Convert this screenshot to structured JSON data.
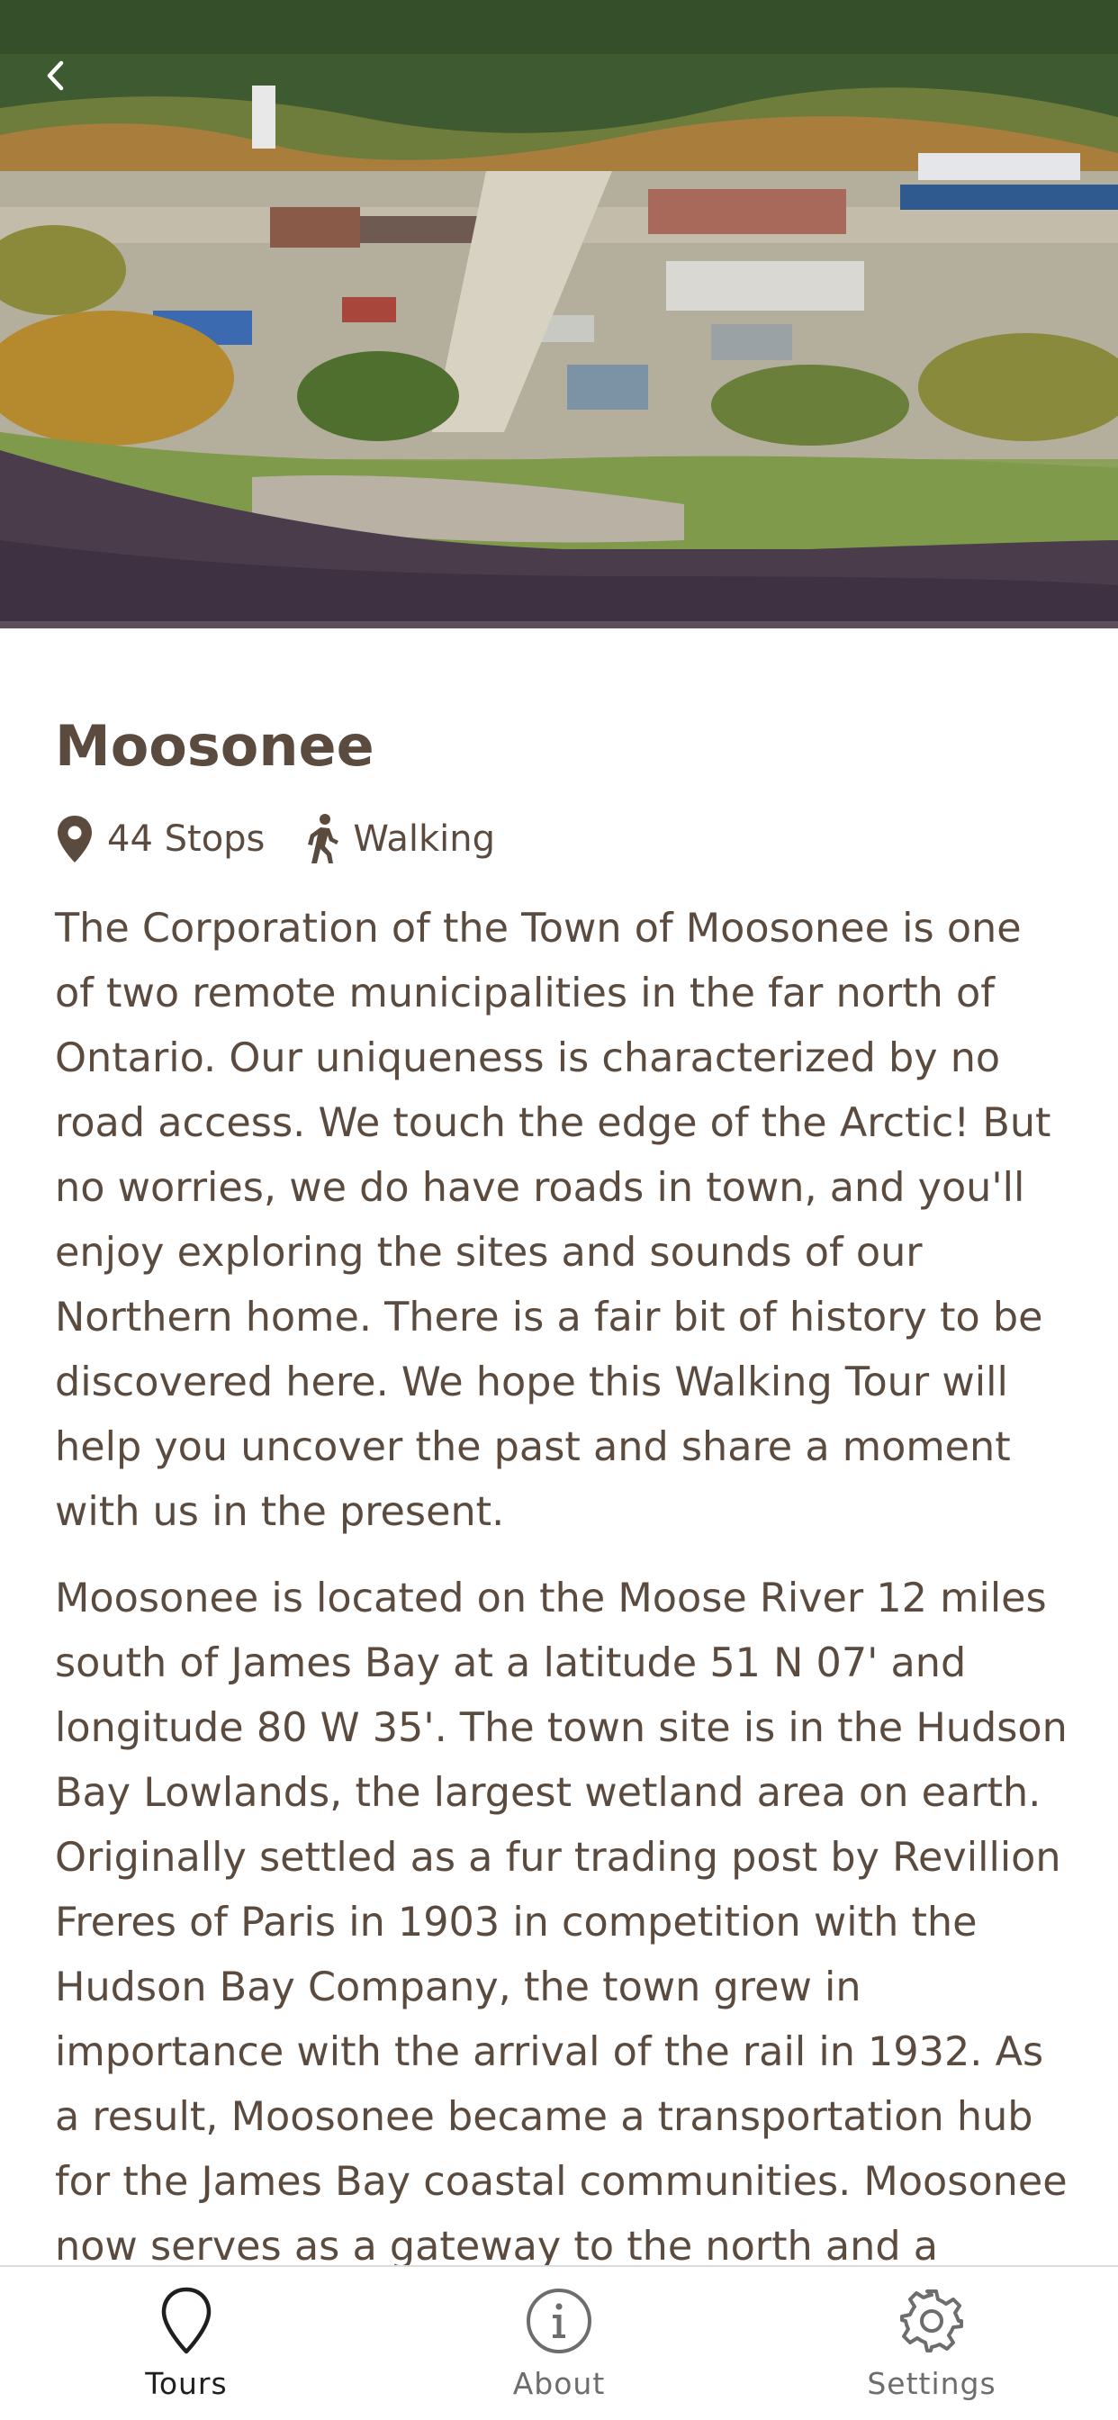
{
  "hero": {
    "image_description_icon": "aerial-town-river-photo",
    "back_icon": "chevron-left-icon"
  },
  "tour": {
    "title": "Moosonee",
    "stops_label": "44 Stops",
    "mode_label": "Walking",
    "paragraphs": [
      "The Corporation of the Town of Moosonee is one of two remote municipalities in the far north of Ontario. Our uniqueness is characterized by no road access. We touch the edge of the Arctic! But no worries, we do have roads in town, and you'll enjoy exploring the sites and sounds of our Northern home. There is a fair bit of history to be discovered here. We hope this Walking Tour will help you uncover the past and share a moment with us in the present.",
      "Moosonee is located on the Moose River 12 miles south of James Bay at a latitude 51 N 07' and longitude 80 W 35'. The town site is in the Hudson Bay Lowlands, the largest wetland area on earth. Originally settled as a fur trading post by Revillion Freres of Paris in 1903 in competition with the Hudson Bay Company, the town grew in importance with the arrival of the rail in 1932. As a result, Moosonee became a transportation hub for the James Bay coastal communities. Moosonee now serves as a gateway to the north and a launching"
    ]
  },
  "tabs": [
    {
      "label": "Tours",
      "icon": "map-pin-icon",
      "active": true
    },
    {
      "label": "About",
      "icon": "info-icon",
      "active": false
    },
    {
      "label": "Settings",
      "icon": "gear-icon",
      "active": false
    }
  ],
  "colors": {
    "text": "#5b4b3f",
    "tab_active": "#1f1f1f",
    "tab_inactive": "#6d6d6d"
  }
}
